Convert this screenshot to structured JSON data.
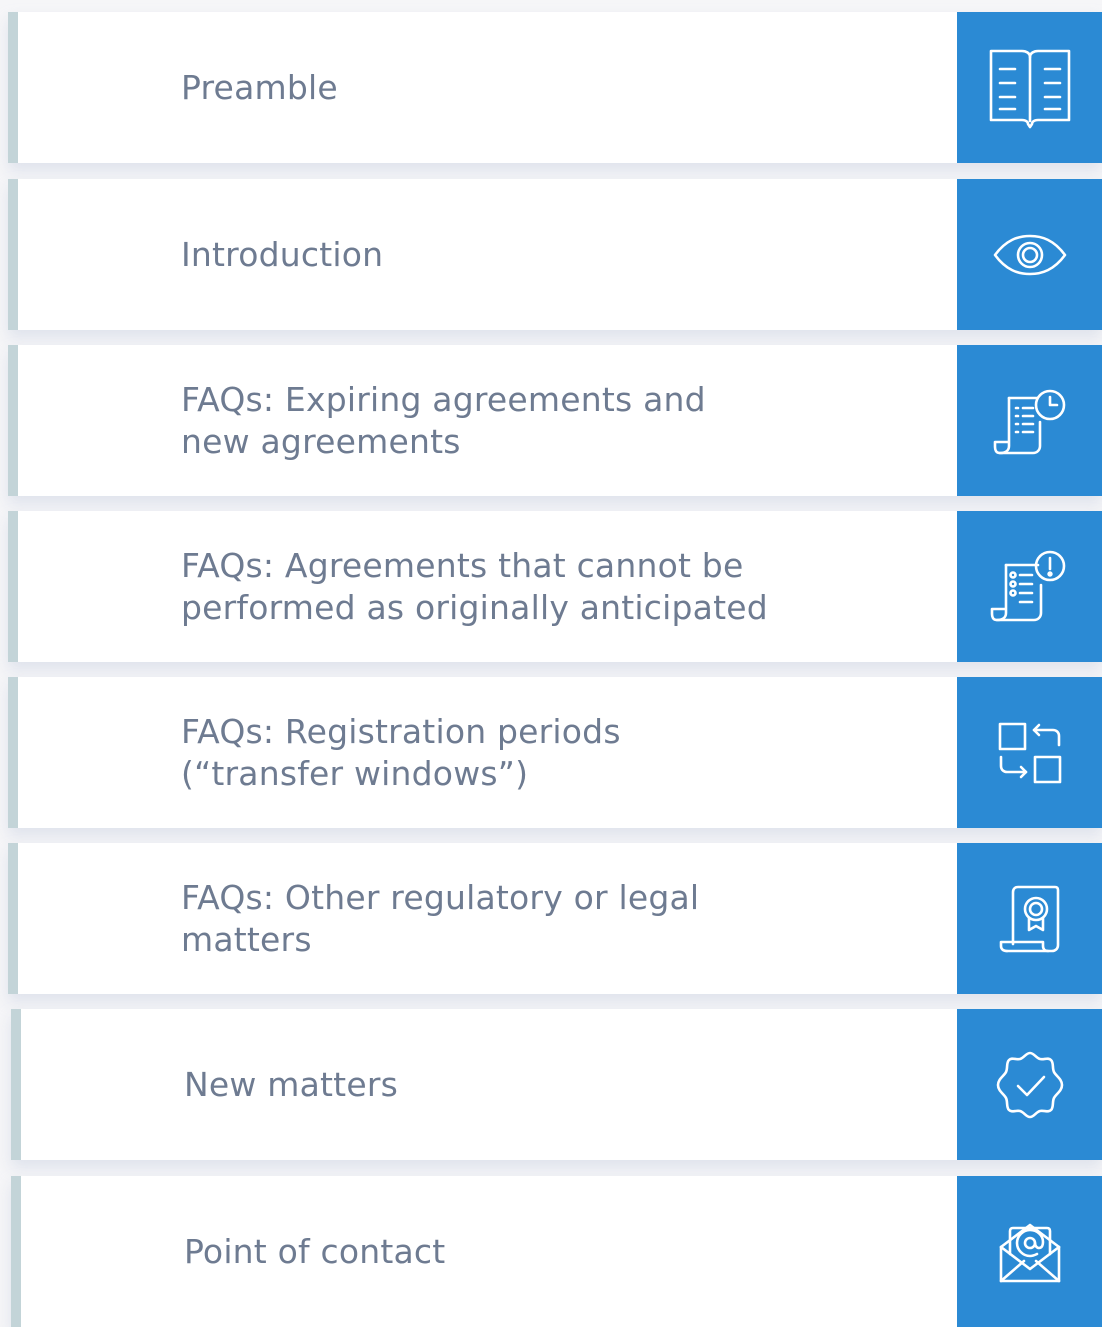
{
  "menu": {
    "items": [
      {
        "label": "Preamble",
        "icon": "open-book-icon"
      },
      {
        "label": "Introduction",
        "icon": "eye-icon"
      },
      {
        "label": "FAQs: Expiring agreements and\nnew agreements",
        "icon": "document-clock-icon"
      },
      {
        "label": "FAQs: Agreements that cannot be\nperformed as originally anticipated",
        "icon": "document-alert-icon"
      },
      {
        "label": "FAQs: Registration periods\n(“transfer windows”)",
        "icon": "transfer-arrows-icon"
      },
      {
        "label": "FAQs: Other regulatory or legal matters",
        "icon": "certificate-icon"
      },
      {
        "label": "New matters",
        "icon": "verified-badge-icon"
      },
      {
        "label": "Point of contact",
        "icon": "email-envelope-icon"
      }
    ]
  },
  "colors": {
    "page_background": "#f6f6f8",
    "card_background": "#ffffff",
    "accent_stripe": "#c3d4d8",
    "icon_panel": "#2b8ad4",
    "label_text": "#6e7b91",
    "icon_stroke": "#ffffff"
  }
}
